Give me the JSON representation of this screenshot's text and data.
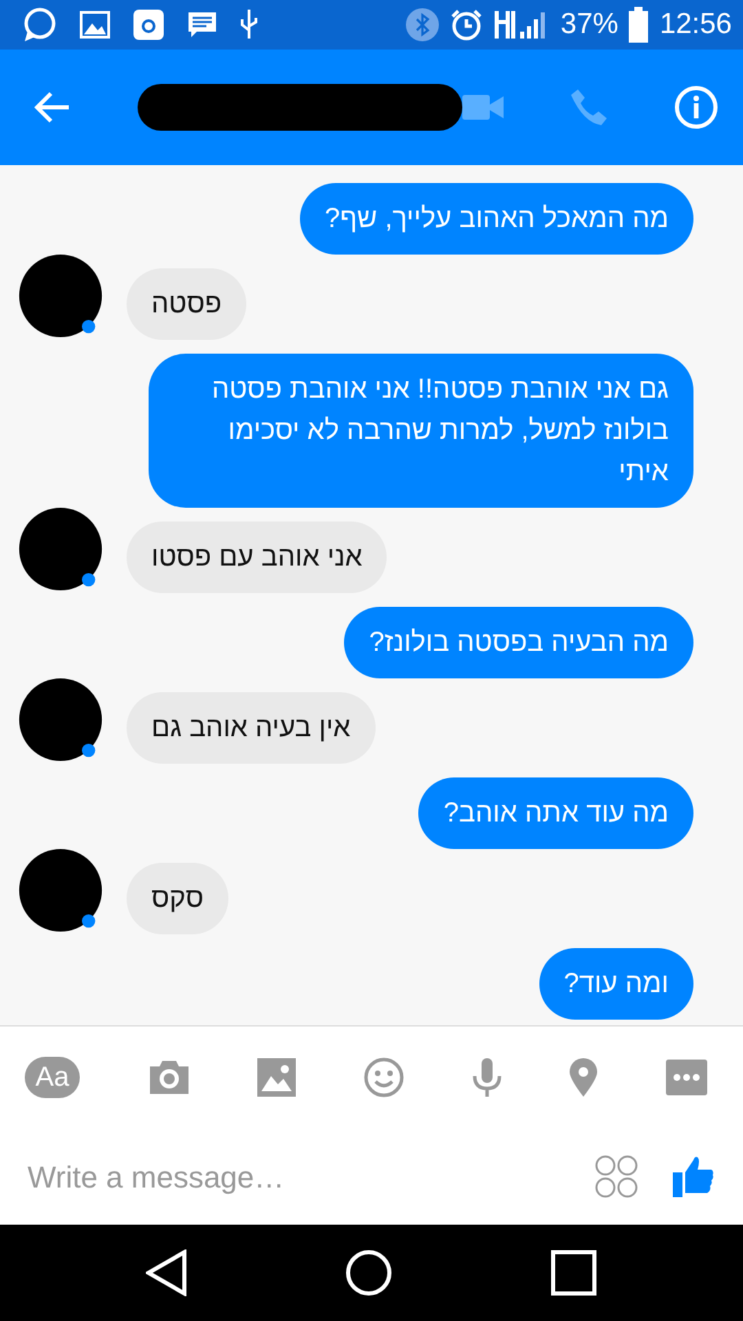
{
  "status_bar": {
    "battery": "37%",
    "time": "12:56"
  },
  "header": {
    "video_call_disabled": true,
    "voice_call_disabled": true
  },
  "messages": [
    {
      "kind": "out",
      "text": "מה המאכל האהוב עלייך, שף?"
    },
    {
      "kind": "in",
      "text": "פסטה"
    },
    {
      "kind": "out",
      "text": "גם אני אוהבת פסטה!! אני אוהבת פסטה בולונז למשל, למרות שהרבה לא יסכימו איתי"
    },
    {
      "kind": "in",
      "text": "אני אוהב עם פסטו"
    },
    {
      "kind": "out",
      "text": "מה הבעיה בפסטה בולונז?"
    },
    {
      "kind": "in",
      "text": "אין בעיה אוהב גם"
    },
    {
      "kind": "out",
      "text": "מה עוד אתה אוהב?"
    },
    {
      "kind": "in",
      "text": "סקס"
    },
    {
      "kind": "out",
      "text": "ומה עוד?"
    }
  ],
  "composer": {
    "text_button": "Aa",
    "placeholder": "Write a message…"
  }
}
